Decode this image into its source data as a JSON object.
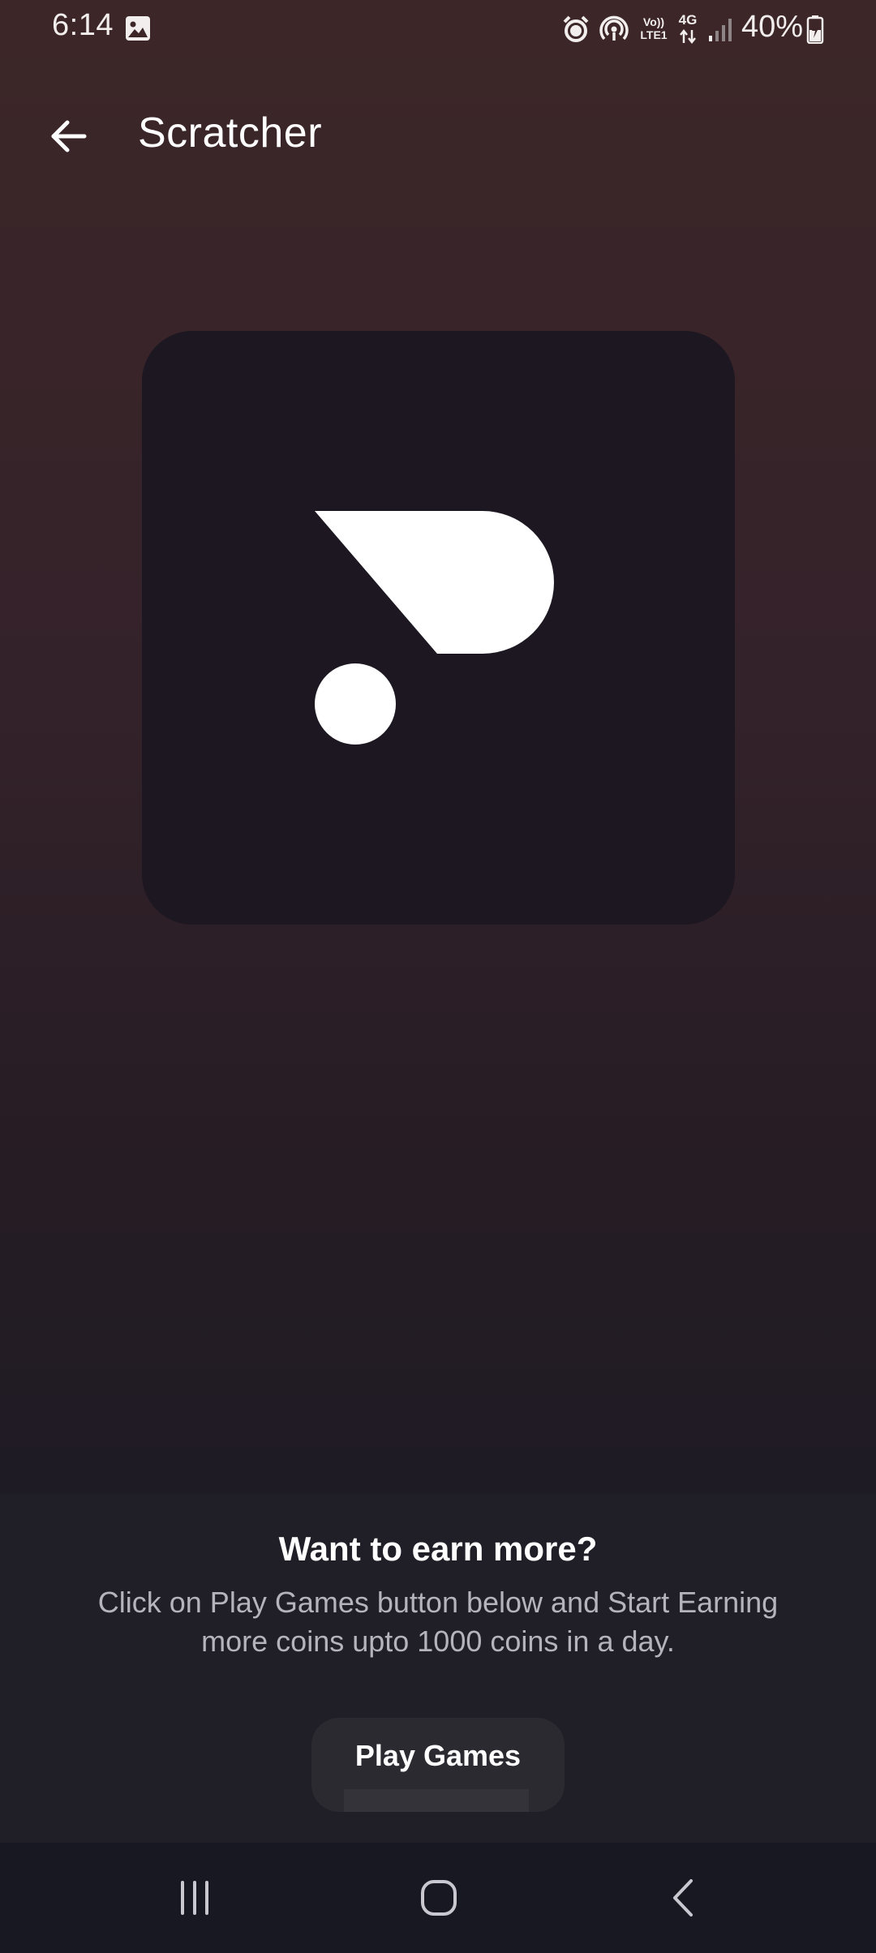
{
  "status_bar": {
    "time": "6:14",
    "battery_percent": "40%",
    "network_label": "4G",
    "volte_label_top": "Vo))",
    "volte_label_bottom": "LTE1",
    "icons": [
      "gallery-icon",
      "alarm-icon",
      "hotspot-icon",
      "volte-icon",
      "network-4g-icon",
      "signal-icon",
      "battery-charging-icon"
    ]
  },
  "app_bar": {
    "title": "Scratcher",
    "back_icon": "arrow-left-icon"
  },
  "logo": {
    "icon": "scratcher-logo-icon",
    "card_color": "#1c1721",
    "mark_color": "#ffffff"
  },
  "promo": {
    "heading": "Want to earn more?",
    "line1": "Click on Play Games button below and Start Earning",
    "line2": "more coins upto 1000 coins in a day.",
    "button_label": "Play Games"
  },
  "nav_bar": {
    "icons": [
      "recent-apps-icon",
      "home-icon",
      "back-nav-icon"
    ]
  },
  "colors": {
    "background_top": "#3c2628",
    "background_bottom": "#1b1b24",
    "panel": "#201e27",
    "button": "#2c2a31",
    "secondary_text": "#b5b3bb"
  }
}
